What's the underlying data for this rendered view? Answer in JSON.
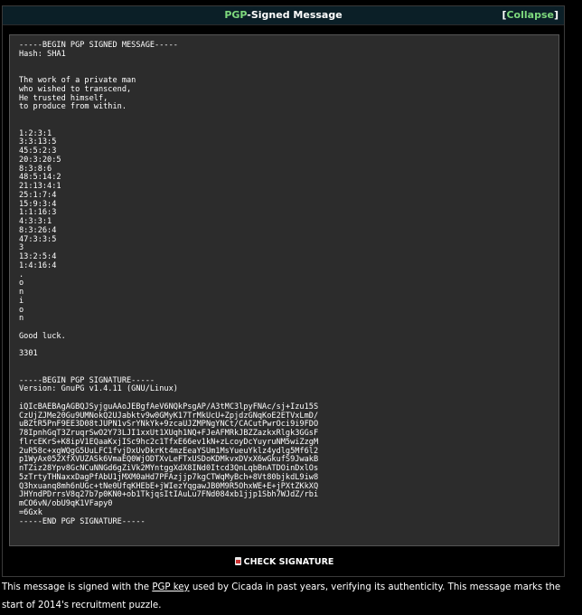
{
  "header": {
    "title_accent": "PGP",
    "title_rest": "-Signed Message",
    "collapse_open": "[",
    "collapse_label": "Collapse",
    "collapse_close": "]"
  },
  "message": {
    "lines": [
      "-----BEGIN PGP SIGNED MESSAGE-----",
      "Hash: SHA1",
      "",
      "",
      "The work of a private man",
      "who wished to transcend,",
      "He trusted himself,",
      "to produce from within.",
      "",
      "",
      "1:2:3:1",
      "3:3:13:5",
      "45:5:2:3",
      "20:3:20:5",
      "8:3:8:6",
      "48:5:14:2",
      "21:13:4:1",
      "25:1:7:4",
      "15:9:3:4",
      "1:1:16:3",
      "4:3:3:1",
      "8:3:26:4",
      "47:3:3:5",
      "3",
      "13:2:5:4",
      "1:4:16:4",
      ".",
      "o",
      "n",
      "i",
      "o",
      "n",
      "",
      "Good luck.",
      "",
      "3301",
      "",
      "",
      "-----BEGIN PGP SIGNATURE-----",
      "Version: GnuPG v1.4.11 (GNU/Linux)",
      "",
      "iQIcBAEBAgAGBQJSyjguAAoJEBgfAeV6NQkPsgAP/A3tMC3lpyFNAc/sj+Izu15S",
      "CzUjZJMe20Gu9UMNokQ2UJabktv9w0GMyK17TrMkUcU+ZpjdzGNqKoE2ETVxLmD/",
      "uBZtR5PnF9EE3D08tJUPN1vSrYNkYk+9zcaUJZMPNgYNCt/CACutPwrOci9i9FDO",
      "78IpnhGqT3ZruqrSwO2Y73LJI1xxUt1XUqh1NQ+FJeAFMRkJBZZazkxRlgk3GGsF",
      "flrcEKrS+K8ipV1EQaaKxjISc9hc2c1TfxE66ev1kN+zLcoyDcYuyruNM5wiZzgM",
      "2uR58c+xgWQgG5UuLFC1fvjDxUvDkrKt4mzEeaYSUm1MsYueuYklz4ydlg5Mf6l2",
      "p1WyAx052XfXVUZASk6VmaEQ0WjODTXvLeFTxUSDoKDMkvxDVxX6wGkufS9JwakB",
      "nTZiz28Ypv8GcNCuNNGd6gZiVk2MYntggXdX8INd0Itcd3QnLqbBnATDOinDxlOs",
      "5zTrtyTHNaxxDagPfAbU1jMXM0aHd7PFAzjjp7kgCTWqMyBch+8Vt80bjkdL9iw8",
      "Q3hxuanq8mh6nUGc+tNe0UfqKHEbE+jWIezYqgawJB0M9R5OhxWE+E+jPXtZKkXQ",
      "JHYndPDrrsV8q27b7p0KN0+ob1TkjqsItIAuLu7FNd084xb1jjp1Sbh7WJdZ/rbi",
      "mCO6vN/obU9qK1VFapy0",
      "=6Gxk",
      "-----END PGP SIGNATURE-----"
    ]
  },
  "check_signature_label": "CHECK SIGNATURE",
  "caption": {
    "text_before": "This message is signed with the ",
    "link_label": "PGP key",
    "text_after": " used by Cicada in past years, verifying its authenticity. This message marks the start of 2014's recruitment puzzle."
  },
  "colors": {
    "accent": "#7dd87d",
    "panel_bg": "#2c2c2c",
    "title_bg": "#0b1f27"
  }
}
